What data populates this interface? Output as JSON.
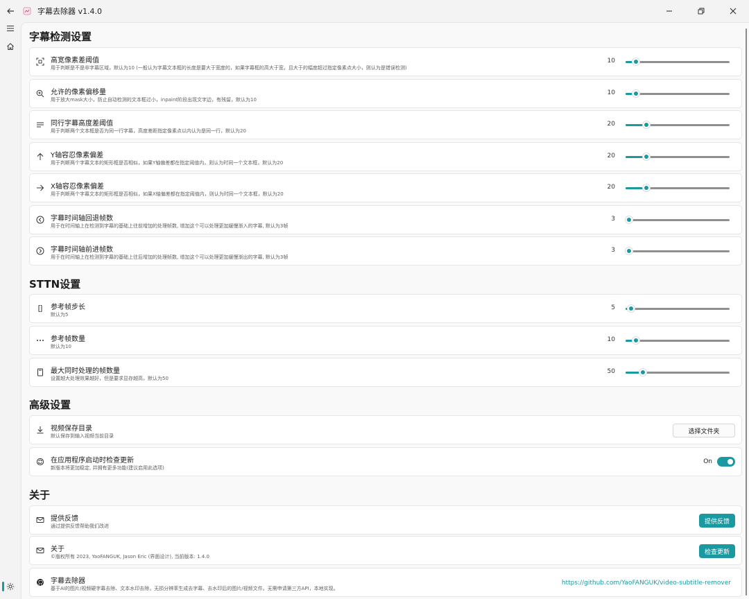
{
  "window": {
    "title": "字幕去除器 v1.4.0"
  },
  "sections": {
    "detection": "字幕检测设置",
    "sttn": "STTN设置",
    "advanced": "高级设置",
    "about": "关于"
  },
  "detection_settings": [
    {
      "title": "高宽像素差阈值",
      "desc": "用于判断是不是非字幕区域，默认为10 (一般认为字幕文本框的长度是要大于宽度的，如果字幕框的高大于宽，且大于的幅度超过指定像素点大小，则认为是错误检测)",
      "value": "10",
      "slider": {
        "min": 0,
        "max": 100,
        "value": 10
      },
      "icon": "frame-icon"
    },
    {
      "title": "允许的像素偏移量",
      "desc": "用于放大mask大小，防止自动检测的文本框过小，inpaint阶段出现文字边，有残留，默认为10",
      "value": "10",
      "slider": {
        "min": 0,
        "max": 100,
        "value": 10
      },
      "icon": "zoom-in-icon"
    },
    {
      "title": "同行字幕高度差阈值",
      "desc": "用于判断两个文本框是否为同一行字幕，高度差距指定像素点以内认为是同一行，默认为20",
      "value": "20",
      "slider": {
        "min": 0,
        "max": 100,
        "value": 20
      },
      "icon": "lines-icon"
    },
    {
      "title": "Y轴容忍像素偏差",
      "desc": "用于判断两个字幕文本的矩形框是否相似，如果Y轴偏差都在指定阈值内，则认为时同一个文本框，默认为20",
      "value": "20",
      "slider": {
        "min": 0,
        "max": 100,
        "value": 20
      },
      "icon": "arrow-up-icon"
    },
    {
      "title": "X轴容忍像素偏差",
      "desc": "用于判断两个字幕文本的矩形框是否相似，如果X轴偏差都在指定阈值内，则认为时同一个文本框，默认为20",
      "value": "20",
      "slider": {
        "min": 0,
        "max": 100,
        "value": 20
      },
      "icon": "arrow-right-icon"
    },
    {
      "title": "字幕时间轴回退帧数",
      "desc": "用于在时间轴上在检测到字幕的基础上往前增加的处理帧数, 增加这个可以处理更加缓慢渐入的字幕, 默认为3帧",
      "value": "3",
      "slider": {
        "min": 0,
        "max": 100,
        "value": 3
      },
      "icon": "chevron-left-circle-icon"
    },
    {
      "title": "字幕时间轴前进帧数",
      "desc": "用于在时间轴上在检测到字幕的基础上往后增加的处理帧数, 增加这个可以处理更加缓慢渐出的字幕, 默认为3帧",
      "value": "3",
      "slider": {
        "min": 0,
        "max": 100,
        "value": 3
      },
      "icon": "chevron-right-circle-icon"
    }
  ],
  "sttn_settings": [
    {
      "title": "参考帧步长",
      "desc": "默认为5",
      "value": "5",
      "slider": {
        "min": 0,
        "max": 100,
        "value": 5
      },
      "icon": "step-icon"
    },
    {
      "title": "参考帧数量",
      "desc": "默认为10",
      "value": "10",
      "slider": {
        "min": 0,
        "max": 100,
        "value": 10
      },
      "icon": "more-icon"
    },
    {
      "title": "最大同时处理的帧数量",
      "desc": "设置越大处理效果越好，但是要求显存越高，默认为50",
      "value": "50",
      "slider": {
        "min": 0,
        "max": 300,
        "value": 50
      },
      "icon": "memory-icon"
    }
  ],
  "advanced": {
    "save_dir": {
      "title": "视频保存目录",
      "desc": "默认保存到输入视频当前目录",
      "button": "选择文件夹"
    },
    "update_check": {
      "title": "在应用程序启动时检查更新",
      "desc": "新版本将更加稳定, 并拥有更多功能(建议启用此选项)",
      "state_label": "On",
      "enabled": true
    }
  },
  "about": {
    "feedback": {
      "title": "提供反馈",
      "desc": "通过提供反馈帮助我们改进",
      "button": "提供反馈"
    },
    "about": {
      "title": "关于",
      "desc": "©版权所有 2023, YaoFANGUK, Jason Eric (界面设计), 当前版本: 1.4.0",
      "button": "检查更新"
    },
    "repo": {
      "title": "字幕去除器",
      "desc": "基于AI的图片/视频硬字幕去除、文本水印去除，无损分辨率生成去字幕、去水印后的图片/视频文件。无需申请第三方API，本地实现。",
      "link": "https://github.com/YaoFANGUK/video-subtitle-remover"
    }
  },
  "colors": {
    "accent": "#1a9aa0"
  }
}
